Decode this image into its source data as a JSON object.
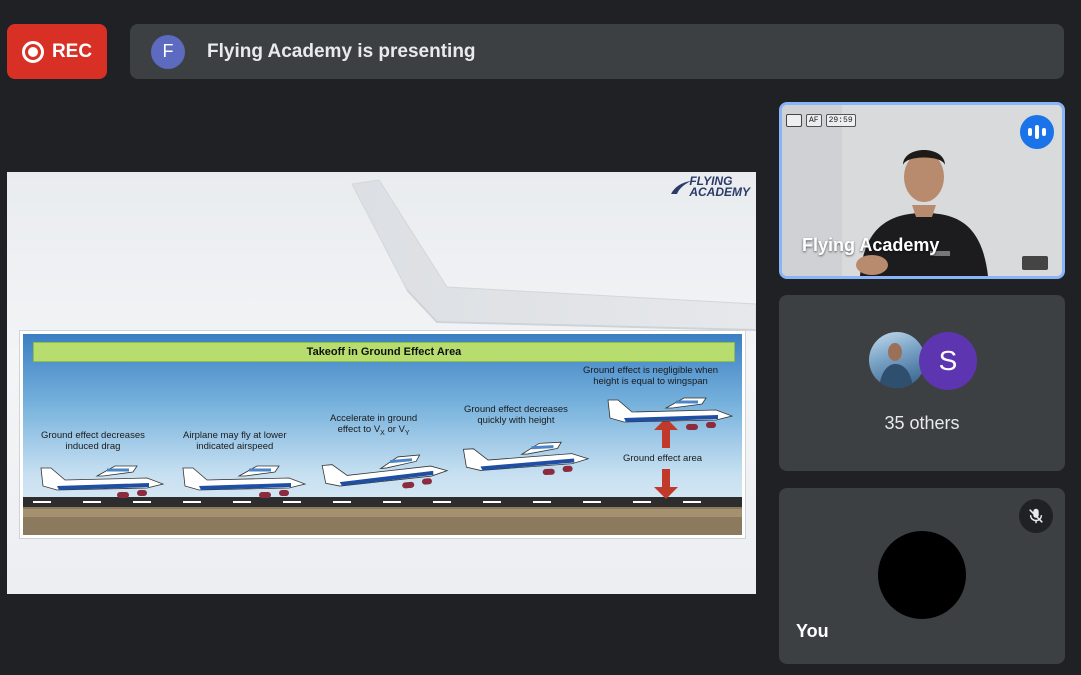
{
  "recording": {
    "label": "REC"
  },
  "banner": {
    "avatar_initial": "F",
    "text": "Flying Academy is presenting"
  },
  "slide": {
    "logo_line1": "FLYING",
    "logo_line2": "ACADEMY",
    "diagram_title": "Takeoff in Ground Effect Area",
    "labels": {
      "stage1": [
        "Ground effect decreases",
        "induced drag"
      ],
      "stage2": [
        "Airplane may fly at lower",
        "indicated airspeed"
      ],
      "stage3_line1": "Accelerate in ground",
      "stage3_line2": "effect to V",
      "stage3_sub1": "X",
      "stage3_or": " or V",
      "stage3_sub2": "Y",
      "stage4": [
        "Ground effect decreases",
        "quickly with height"
      ],
      "stage5": [
        "Ground effect is negligible when",
        "height is equal to wingspan"
      ],
      "ground_effect_area": "Ground effect area"
    }
  },
  "tiles": {
    "presenter": {
      "name": "Flying Academy",
      "hud_time": "29:59"
    },
    "others": {
      "avatar_initial": "S",
      "label": "35 others"
    },
    "self": {
      "label": "You"
    }
  },
  "colors": {
    "rec": "#d93025",
    "tile_bg": "#3c4043",
    "page_bg": "#202124",
    "active_border": "#8ab4f8",
    "speaking": "#1a73e8"
  }
}
